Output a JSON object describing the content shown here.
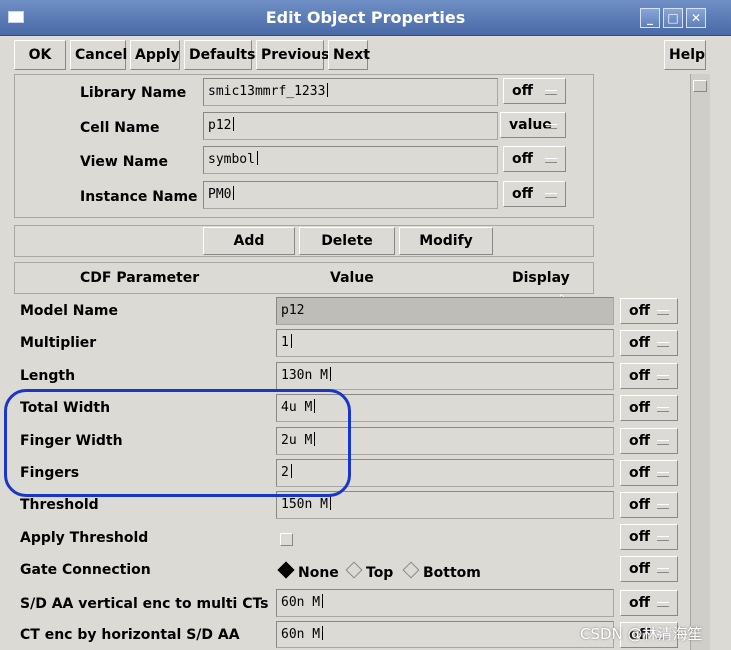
{
  "window": {
    "title": "Edit Object Properties",
    "controls": [
      "_",
      "□",
      "✕"
    ]
  },
  "toolbar": {
    "buttons": [
      "OK",
      "Cancel",
      "Apply",
      "Defaults",
      "Previous",
      "Next"
    ],
    "help": "Help"
  },
  "instance": [
    {
      "label": "Library Name",
      "value": "smic13mmrf_1233",
      "display": "off"
    },
    {
      "label": "Cell Name",
      "value": "p12",
      "display": "value"
    },
    {
      "label": "View Name",
      "value": "symbol",
      "display": "off"
    },
    {
      "label": "Instance Name",
      "value": "PM0",
      "display": "off"
    }
  ],
  "actions": {
    "add": "Add",
    "delete": "Delete",
    "modify": "Modify"
  },
  "cdf": {
    "headers": {
      "param": "CDF Parameter",
      "value": "Value",
      "display": "Display"
    },
    "rows": [
      {
        "label": "Model Name",
        "value": "p12",
        "display": "off"
      },
      {
        "label": "Multiplier",
        "value": "1",
        "display": "off"
      },
      {
        "label": "Length",
        "value": "130n M",
        "display": "off"
      },
      {
        "label": "Total Width",
        "value": "4u M",
        "display": "off"
      },
      {
        "label": "Finger Width",
        "value": "2u M",
        "display": "off"
      },
      {
        "label": "Fingers",
        "value": "2",
        "display": "off"
      },
      {
        "label": "Threshold",
        "value": "150n M",
        "display": "off"
      },
      {
        "label": "Apply Threshold",
        "value": "",
        "display": "off"
      },
      {
        "label": "Gate Connection",
        "value": "",
        "display": "off"
      },
      {
        "label": "S/D AA vertical enc to multi CTs",
        "value": "60n M",
        "display": "off"
      },
      {
        "label": "CT enc by horizontal S/D AA",
        "value": "60n M",
        "display": "off"
      }
    ],
    "gate_options": [
      "None",
      "Top",
      "Bottom"
    ],
    "gate_selected": "None"
  },
  "icons": {
    "pointer": "mouse-pointer-icon",
    "window": "window-menu-icon"
  },
  "colors": {
    "titlebar": "#4a6aa8",
    "annotation": "#1a36c8"
  },
  "watermark": "CSDN @林清海笙"
}
